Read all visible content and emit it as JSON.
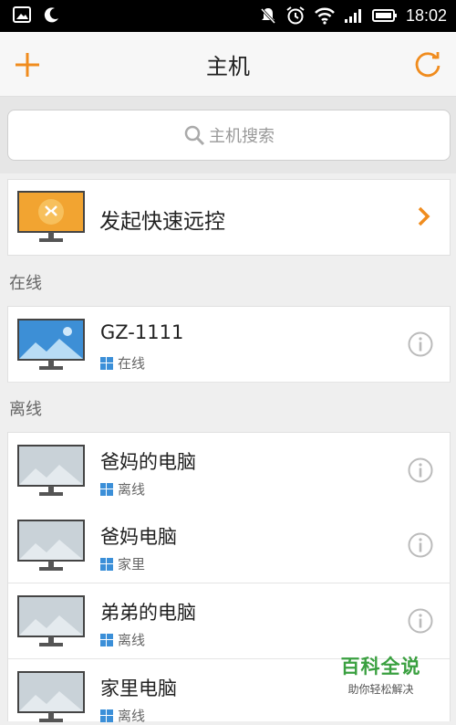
{
  "status_bar": {
    "time": "18:02"
  },
  "header": {
    "title": "主机"
  },
  "search": {
    "placeholder": "主机搜索"
  },
  "quick_connect": {
    "label": "发起快速远控"
  },
  "sections": {
    "online_label": "在线",
    "offline_label": "离线"
  },
  "online_hosts": [
    {
      "name": "GZ-1111",
      "status": "在线"
    }
  ],
  "offline_hosts": [
    {
      "name": "爸妈的电脑",
      "status": "离线"
    },
    {
      "name": "爸妈电脑",
      "status": "家里"
    },
    {
      "name": "弟弟的电脑",
      "status": "离线"
    },
    {
      "name": "家里电脑",
      "status": "离线"
    }
  ],
  "watermark": {
    "title": "百科全说",
    "subtitle": "助你轻松解决"
  },
  "colors": {
    "accent": "#f08c1e",
    "online_screen": "#3d8fd6",
    "offline_screen": "#c9d2d8",
    "windows": "#3b8fd8"
  }
}
